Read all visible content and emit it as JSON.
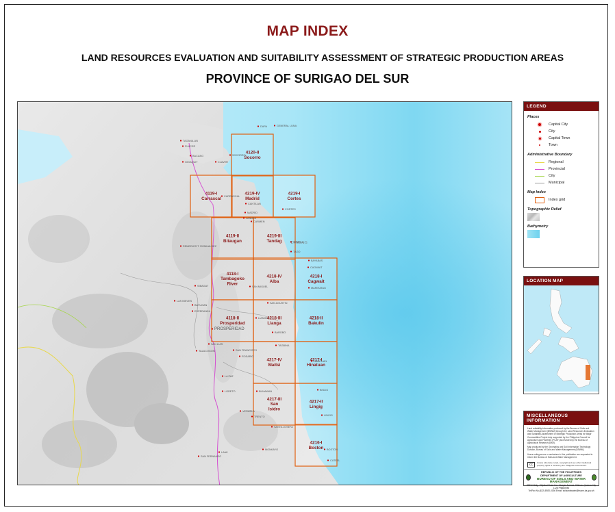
{
  "header": {
    "title": "MAP INDEX",
    "subtitle": "LAND RESOURCES EVALUATION AND SUITABILITY ASSESSMENT OF STRATEGIC PRODUCTION AREAS",
    "province": "PROVINCE OF SURIGAO DEL SUR"
  },
  "map": {
    "grid_cells": [
      {
        "code": "4120-II",
        "name": "Socorro"
      },
      {
        "code": "4119-I",
        "name": "Carrascal"
      },
      {
        "code": "4219-IV",
        "name": "Madrid"
      },
      {
        "code": "4219-I",
        "name": "Cortes"
      },
      {
        "code": "4119-II",
        "name": "Bitaugan"
      },
      {
        "code": "4219-III",
        "name": "Tandag"
      },
      {
        "code": "4118-I",
        "name": "Tambagoko River"
      },
      {
        "code": "4218-IV",
        "name": "Alba"
      },
      {
        "code": "4218-I",
        "name": "Cagwait"
      },
      {
        "code": "4118-II",
        "name": "Prosperidad"
      },
      {
        "code": "4218-III",
        "name": "Lianga"
      },
      {
        "code": "4218-II",
        "name": "Bakulin"
      },
      {
        "code": "4217-IV",
        "name": "Maitsi"
      },
      {
        "code": "4217-I",
        "name": "Hinatuan"
      },
      {
        "code": "4217-III",
        "name": "San Isidro"
      },
      {
        "code": "4217-II",
        "name": "Lingig"
      },
      {
        "code": "4216-I",
        "name": "Boston"
      }
    ],
    "place_labels": [
      "DAPA",
      "GENERAL LUNA",
      "TAGANA-AN",
      "PLACER",
      "BACUAG",
      "GIGAQUIT",
      "CLAVER",
      "SOCORRO",
      "CARRASCAL",
      "CANTILAN",
      "MADRID",
      "CORTES",
      "CARMEN",
      "LANUZA",
      "TANDAG",
      "TAGO",
      "BAYABAS",
      "CAGWAIT",
      "MARIHATAG",
      "REMEDIOS T. ROMUALDEZ",
      "SAN MIGUEL",
      "SIBAGAT",
      "LAS NIEVES",
      "BAYUGAN",
      "ESPERANZA",
      "SAN AGUSTIN",
      "LIANGA",
      "BAROBO",
      "PROSPERIDAD",
      "SAN LUIS",
      "TALACOGON",
      "SAN FRANCISCO",
      "ROSARIO",
      "TAGBINA",
      "HINATUAN",
      "LA PAZ",
      "LORETO",
      "BUNAWAN",
      "BISLIG",
      "VERUELA",
      "TRENTO",
      "SANTA JOSEFA",
      "LINGIG",
      "BOSTON",
      "SAN FERNANDO",
      "LAAK",
      "MONKAYO",
      "CATEEL"
    ],
    "water_label": "TANDAG"
  },
  "legend": {
    "heading": "LEGEND",
    "places_title": "Places",
    "places": [
      "Capital City",
      "City",
      "Capital Town",
      "Town"
    ],
    "admin_title": "Administrative Boundary",
    "admin": [
      {
        "label": "Regional",
        "color": "#e8d84a"
      },
      {
        "label": "Provincial",
        "color": "#d44fd1"
      },
      {
        "label": "City",
        "color": "#a6d64a"
      },
      {
        "label": "Municipal",
        "color": "#9a9a9a"
      }
    ],
    "mapindex_title": "Map Index",
    "mapindex_item": "Index grid",
    "relief_title": "Topographic Relief",
    "bathy_title": "Bathymetry"
  },
  "location_map": {
    "heading": "LOCATION MAP"
  },
  "misc": {
    "heading": "MISCELLANEOUS INFORMATION",
    "para1": "Land suitability information produced by the Bureau of Soils and Water Management (BSWM) through the Land Resources Evaluation and Suitability Assessment of Strategic Production Areas for Major Commodities Project duly supported by the Philippine Council for Agriculture and Fisheries (PCAF) and funded by the Bureau of Agricultural Research (BAR).",
    "para2": "Map produced by the Geomatics and Soil Information Technology Division, Bureau of Soils and Water Management (BSWM).",
    "para3": "Users noting errors or omissions in this publication are requested to inform the Bureau of Soils and Water Management.",
    "license": "Unless otherwise noted, copyright and any other intellectual property rights is owned by the Philippine Government.",
    "dept_line1": "REPUBLIC OF THE PHILIPPINES",
    "dept_line2": "DEPARTMENT OF AGRICULTURE",
    "dept_line3": "BUREAU OF SOILS AND WATER MANAGEMENT",
    "address": "SRDC Bldg., Elliptical Road Cor. Visayas Avenue, Diliman, Quezon City 1128 Philippines",
    "contact": "Tel/Fax No.(632) 8920-0156   Email: soilsandwater@bswm.da.gov.ph"
  }
}
